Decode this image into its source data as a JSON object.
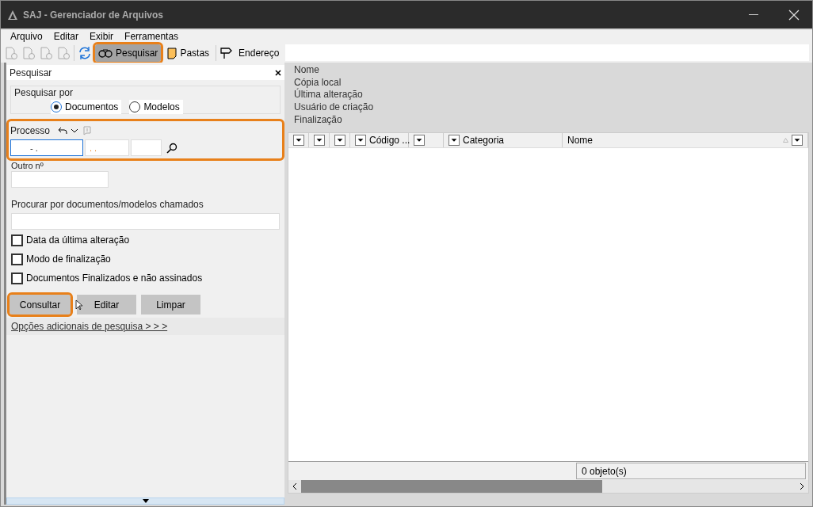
{
  "window": {
    "title": "SAJ - Gerenciador de Arquivos"
  },
  "menu": [
    "Arquivo",
    "Editar",
    "Exibir",
    "Ferramentas"
  ],
  "toolbar": {
    "search": {
      "label": "Pesquisar",
      "selected": true,
      "highlighted": true
    },
    "folders": {
      "label": "Pastas"
    },
    "address": {
      "label": "Endereço"
    }
  },
  "search_panel": {
    "title": "Pesquisar",
    "search_by": {
      "label": "Pesquisar por",
      "options": [
        {
          "label": "Documentos",
          "selected": true
        },
        {
          "label": "Modelos",
          "selected": false
        }
      ]
    },
    "process": {
      "label": "Processo",
      "highlighted": true,
      "value_1": "- .",
      "value_2": ". ."
    },
    "other_number": {
      "label": "Outro nº"
    },
    "name_search": {
      "label": "Procurar por documentos/modelos chamados"
    },
    "checkboxes": [
      {
        "label": "Data da última alteração",
        "checked": false
      },
      {
        "label": "Modo de finalização",
        "checked": false
      },
      {
        "label": "Documentos Finalizados e não assinados",
        "checked": false
      }
    ],
    "buttons": [
      {
        "label": "Consultar",
        "highlighted": true
      },
      {
        "label": "Editar",
        "highlighted": false
      },
      {
        "label": "Limpar",
        "highlighted": false
      }
    ],
    "more_link": "Opções adicionais de pesquisa > > >"
  },
  "details": [
    "Nome",
    "Cópia local",
    "Última alteração",
    "Usuário de criação",
    "Finalização"
  ],
  "table": {
    "columns": [
      {
        "kind": "blank"
      },
      {
        "kind": "blank"
      },
      {
        "kind": "blank"
      },
      {
        "kind": "labeled",
        "label": "Código ..."
      },
      {
        "kind": "blank"
      },
      {
        "kind": "labeled",
        "label": "Categoria"
      },
      {
        "kind": "labeled",
        "label": "Nome",
        "sorted": true
      }
    ]
  },
  "status": "0 objeto(s)"
}
